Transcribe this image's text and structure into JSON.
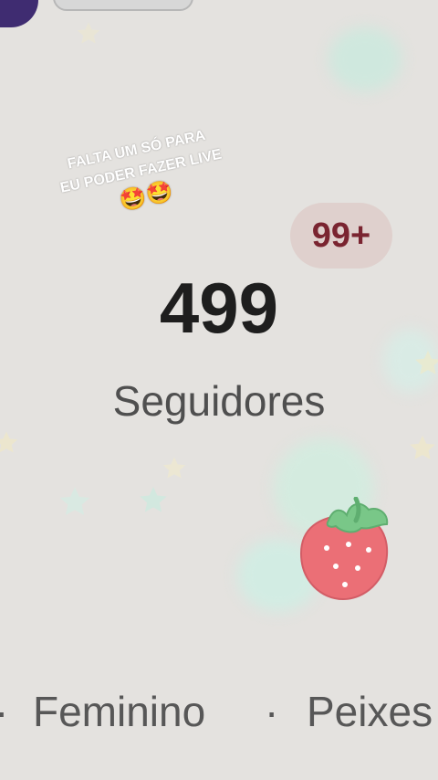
{
  "overlay": {
    "line1": "FALTA UM SÓ PARA",
    "line2": "EU PODER FAZER LIVE",
    "emojis": "🤩🤩"
  },
  "badge": {
    "text": "99+"
  },
  "followers": {
    "count": "499",
    "label": "Seguidores"
  },
  "bottom": {
    "separator_left": "·",
    "gender": "Feminino",
    "separator_mid": "·",
    "sign": "Peixes"
  },
  "colors": {
    "background": "#e4e2df",
    "badge_bg": "#dfd0cd",
    "badge_text": "#7a2430",
    "count_text": "#1e1e1e",
    "sticker_fill": "#eb6f76",
    "sticker_leaf": "#79c788"
  }
}
